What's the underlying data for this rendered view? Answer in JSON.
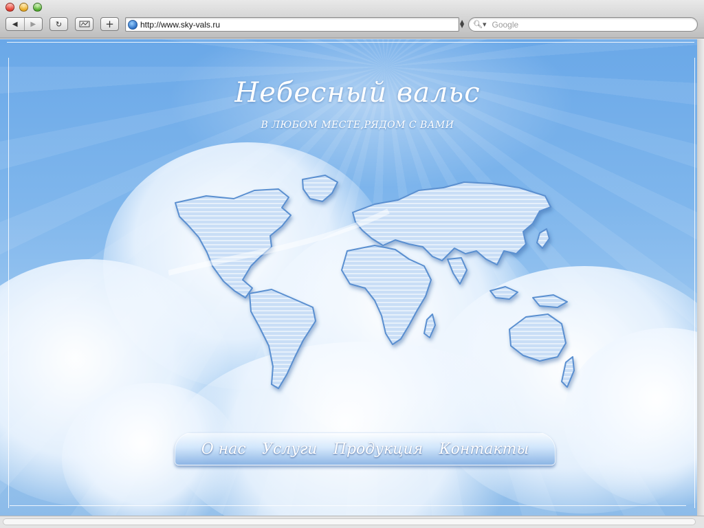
{
  "browser": {
    "url": "http://www.sky-vals.ru",
    "search_placeholder": "Google",
    "buttons": {
      "back": "◀",
      "forward": "▶",
      "reload": "↻",
      "add": "+"
    }
  },
  "page": {
    "title": "Небесный вальс",
    "subtitle": "В ЛЮБОМ МЕСТЕ,РЯДОМ С ВАМИ",
    "menu": [
      {
        "label": "О нас"
      },
      {
        "label": "Услуги"
      },
      {
        "label": "Продукция"
      },
      {
        "label": "Контакты"
      }
    ]
  },
  "colors": {
    "sky": "#7fb6ec",
    "continent_fill": "#c4dcf6",
    "continent_edge": "#5a8fd0"
  }
}
